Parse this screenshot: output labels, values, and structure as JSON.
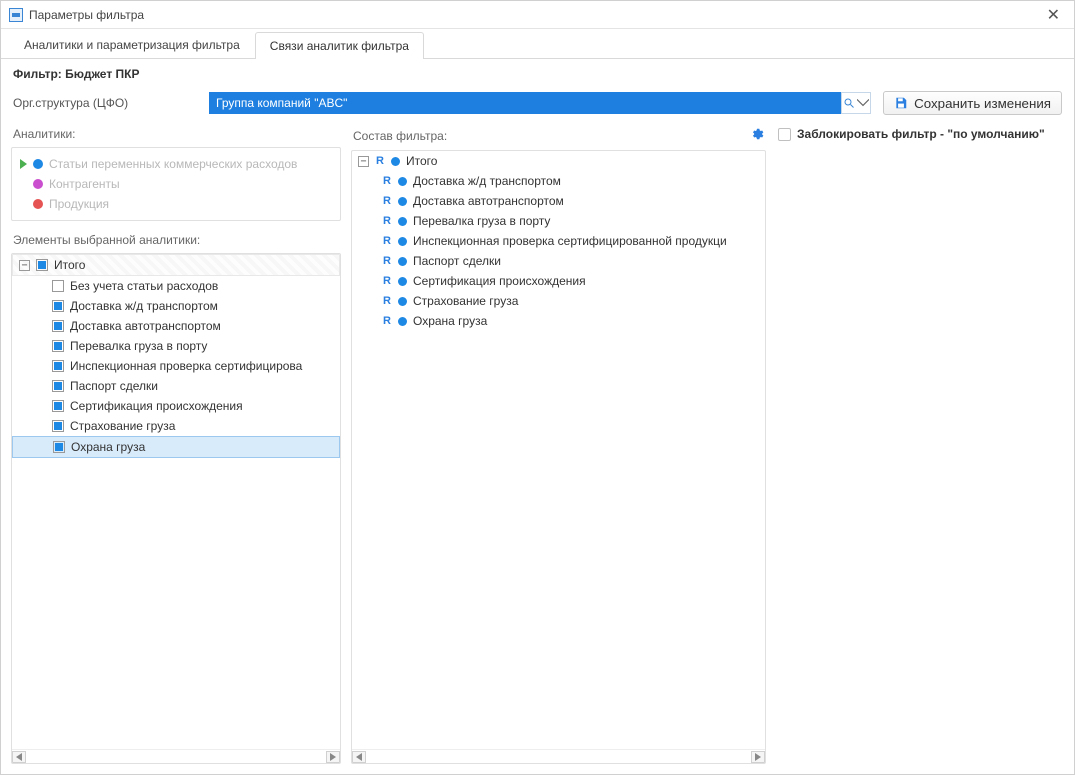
{
  "window": {
    "title": "Параметры фильтра"
  },
  "tabs": [
    {
      "label": "Аналитики и параметризация фильтра",
      "active": false
    },
    {
      "label": "Связи аналитик фильтра",
      "active": true
    }
  ],
  "filter_label_prefix": "Фильтр:",
  "filter_name": "Бюджет ПКР",
  "org_label": "Орг.структура (ЦФО)",
  "org_value": "Группа компаний \"ABC\"",
  "save_label": "Сохранить изменения",
  "analytics_header": "Аналитики:",
  "analytics": [
    {
      "label": "Статьи переменных коммерческих расходов",
      "color": "#1e88e5",
      "enabled": false,
      "has_caret": true
    },
    {
      "label": "Контрагенты",
      "color": "#c94fcf",
      "enabled": false,
      "has_caret": false
    },
    {
      "label": "Продукция",
      "color": "#e55353",
      "enabled": false,
      "has_caret": false
    }
  ],
  "elements_header": "Элементы выбранной аналитики:",
  "elements": {
    "root": {
      "label": "Итого",
      "state": "indeterminate"
    },
    "children": [
      {
        "label": "Без учета статьи расходов",
        "checked": false
      },
      {
        "label": "Доставка ж/д транспортом",
        "checked": true
      },
      {
        "label": "Доставка автотранспортом",
        "checked": true
      },
      {
        "label": "Перевалка груза в порту",
        "checked": true
      },
      {
        "label": "Инспекционная проверка сертифицирова",
        "checked": true
      },
      {
        "label": "Паспорт сделки",
        "checked": true
      },
      {
        "label": "Сертификация происхождения",
        "checked": true
      },
      {
        "label": "Страхование груза",
        "checked": true
      },
      {
        "label": "Охрана груза",
        "checked": true,
        "selected": true
      }
    ]
  },
  "composition_header": "Состав фильтра:",
  "composition": {
    "root": {
      "label": "Итого"
    },
    "children": [
      {
        "label": "Доставка ж/д транспортом"
      },
      {
        "label": "Доставка автотранспортом"
      },
      {
        "label": "Перевалка груза в порту"
      },
      {
        "label": "Инспекционная проверка сертифицированной продукци"
      },
      {
        "label": "Паспорт сделки"
      },
      {
        "label": "Сертификация происхождения"
      },
      {
        "label": "Страхование груза"
      },
      {
        "label": "Охрана груза"
      }
    ]
  },
  "lock_label": "Заблокировать фильтр - \"по умолчанию\""
}
